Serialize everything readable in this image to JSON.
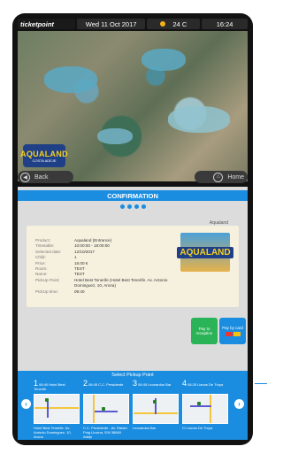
{
  "topbar": {
    "brand": "ticketpoint",
    "date": "Wed 11 Oct 2017",
    "temperature": "24 C",
    "time": "16:24"
  },
  "hero": {
    "logo_text": "AQUALAND",
    "logo_sub": "COSTA ADEJE"
  },
  "nav": {
    "back_label": "Back",
    "home_label": "Home"
  },
  "confirmation": {
    "title": "CONFIRMATION",
    "vendor": "Aqualand",
    "thumb_text": "AQUALAND",
    "details": [
      {
        "key": "Product:",
        "value": "Aqualand (Entrance)"
      },
      {
        "key": "Timetable:",
        "value": "10:00:00 - 18:00:00"
      },
      {
        "key": "Selected date:",
        "value": "12/10/2017"
      },
      {
        "key": "Child:",
        "value": "1"
      },
      {
        "key": "Price:",
        "value": "18.00 €"
      },
      {
        "key": "Room:",
        "value": "TEST"
      },
      {
        "key": "Name:",
        "value": "TEST"
      },
      {
        "key": "PickUp Point:",
        "value": "Hotel Best Tenerife (Hotel Best Tenerife. Av. Antonio Dominguez, 10, Arona)"
      },
      {
        "key": "PickUp time:",
        "value": "09:40"
      }
    ]
  },
  "payment": {
    "reception_label": "Pay to reception",
    "card_label": "Pay by card"
  },
  "pickup": {
    "title": "Select Pickup Point",
    "stops": [
      {
        "num": "1",
        "time_name": "08:40 Hotel Best Tenerife",
        "address": "Hotel Best Tenerife. Av. Antonio Dominguez, 10, Arona"
      },
      {
        "num": "2",
        "time_name": "08:45 C.C. Presidente",
        "address": "C.C. Presidente - Av. Rafael Puig Lluvina, S/N 38660 Adeje"
      },
      {
        "num": "3",
        "time_name": "08:45 Leonardos Bar",
        "address": "Leonardos Bar"
      },
      {
        "num": "4",
        "time_name": "08:25 Llanos De Troya",
        "address": "C/ Llanos De Troya"
      }
    ]
  },
  "colors": {
    "accent": "#1a8de0",
    "green": "#2bb357",
    "card_bg": "#f6f1df"
  }
}
